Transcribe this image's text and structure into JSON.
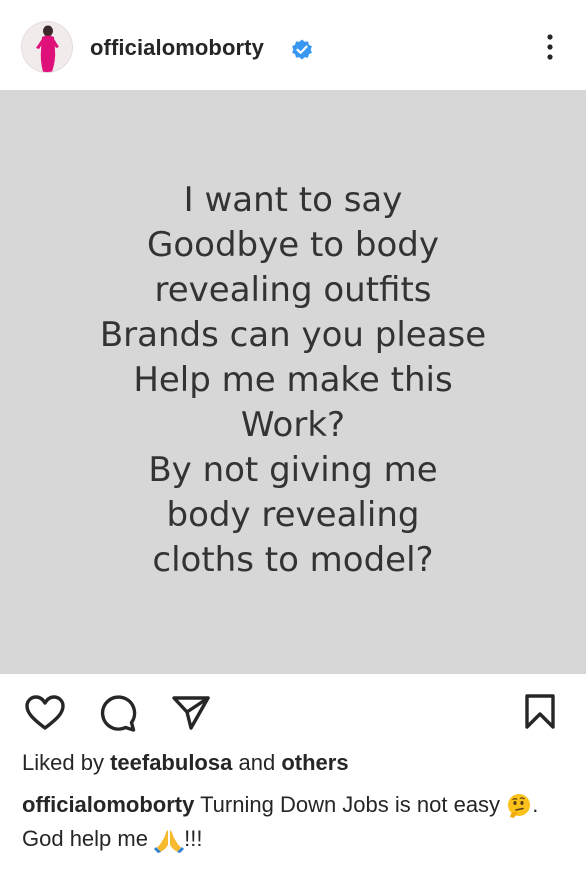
{
  "post": {
    "username": "officialomoborty",
    "image_text_lines": [
      "I want to say",
      "Goodbye to body",
      "revealing outfits",
      "Brands can you please",
      "Help me make this",
      "Work?",
      "By not giving me",
      "body revealing",
      "cloths to model?"
    ],
    "liked_by_prefix": "Liked by",
    "liked_by_user": "teefabulosa",
    "liked_by_and": "and",
    "liked_by_others": "others",
    "caption_username": "officialomoborty",
    "caption_line1": "Turning Down Jobs is not easy",
    "caption_line1_end": ".",
    "caption_line2": "God help me",
    "caption_line2_end": "!!!"
  },
  "icons": {
    "verified": "verified-badge-icon",
    "more": "more-vertical-icon",
    "like": "heart-icon",
    "comment": "comment-icon",
    "share": "send-icon",
    "save": "bookmark-icon",
    "thinking": "thinking-face-emoji",
    "pray": "folded-hands-emoji"
  },
  "colors": {
    "verified": "#3897f0",
    "post_background": "#d7d7d7",
    "text": "#262626"
  }
}
